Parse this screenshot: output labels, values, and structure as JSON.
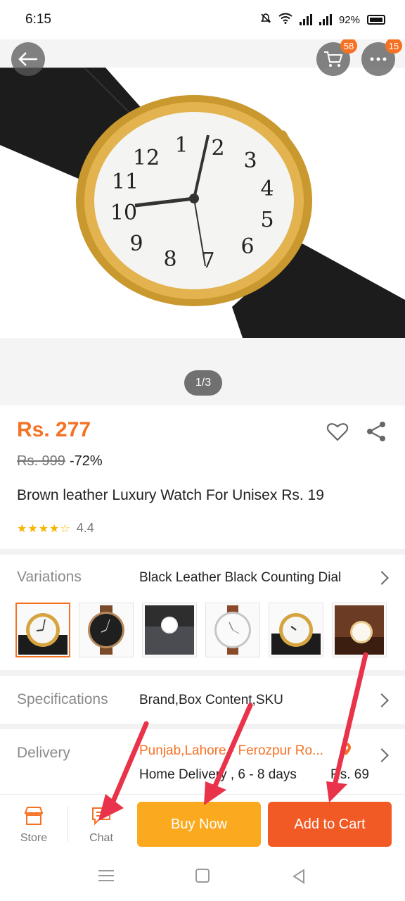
{
  "status_bar": {
    "time": "6:15",
    "battery": "92%"
  },
  "header": {
    "cart_count": "58",
    "more_count": "15"
  },
  "gallery": {
    "image_counter": "1/3"
  },
  "product": {
    "price": "Rs. 277",
    "original_price": "Rs. 999",
    "discount": "-72%",
    "title": "Brown leather Luxury Watch For Unisex Rs. 19",
    "stars": "★★★★☆",
    "rating": "4.4"
  },
  "variations": {
    "label": "Variations",
    "value": "Black Leather Black Counting Dial"
  },
  "specifications": {
    "label": "Specifications",
    "value": "Brand,Box Content,SKU"
  },
  "delivery": {
    "label": "Delivery",
    "location": "Punjab,Lahore - Ferozpur Ro...",
    "time": "Home Delivery , 6 - 8 days",
    "fee": "Rs. 69"
  },
  "action_bar": {
    "store_label": "Store",
    "chat_label": "Chat",
    "buy_now_label": "Buy Now",
    "add_to_cart_label": "Add to Cart"
  },
  "colors": {
    "accent": "#f57224",
    "buy_now": "#fbaa1f",
    "add_to_cart": "#f15a24",
    "annotation_arrow": "#e8334a"
  }
}
